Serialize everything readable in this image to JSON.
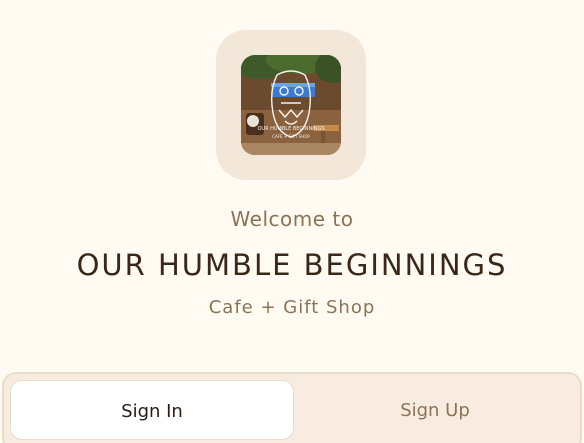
{
  "logo": {
    "icon": "cafe-photo-logo",
    "neon_text_line1": "OUR HUMBLE BEGINNINGS",
    "neon_text_line2": "CAFE + GIFT SHOP"
  },
  "welcome_text": "Welcome to",
  "brand_name": "OUR HUMBLE BEGINNINGS",
  "tagline": "Cafe + Gift Shop",
  "auth": {
    "tabs": [
      {
        "label": "Sign In",
        "active": true
      },
      {
        "label": "Sign Up",
        "active": false
      }
    ]
  },
  "colors": {
    "background": "#fffbf3",
    "tile": "#f2e7d8",
    "brand_text": "#3a2718",
    "muted_text": "#8b7355"
  }
}
